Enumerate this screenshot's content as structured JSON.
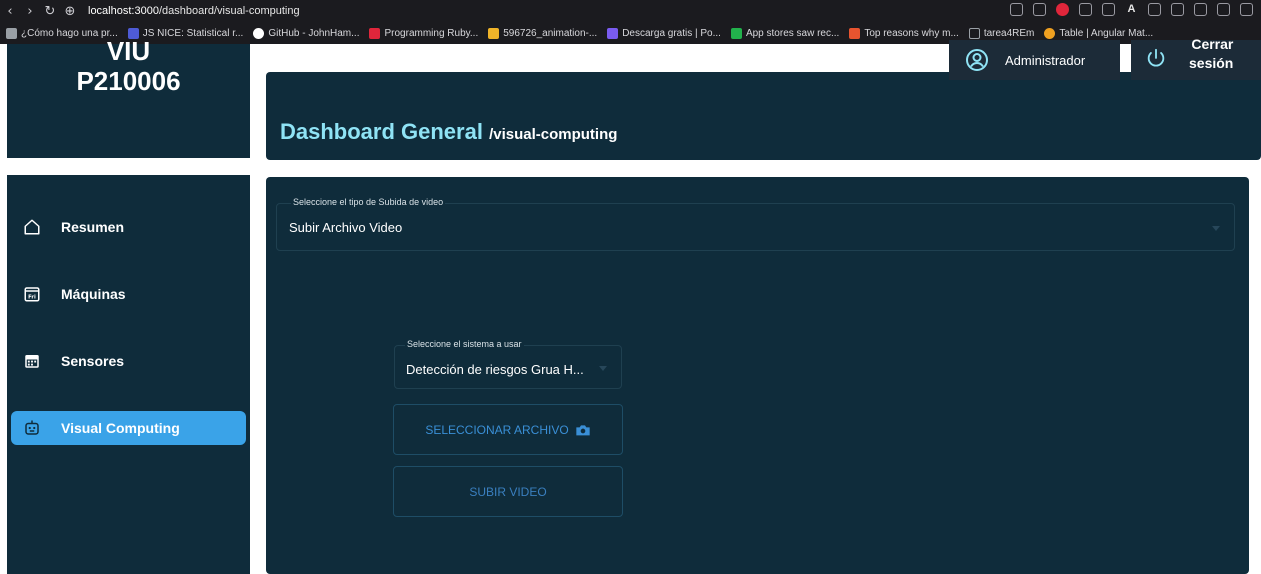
{
  "browser": {
    "url_host": "localhost:3000",
    "url_path": "/dashboard/visual-computing",
    "bookmarks": [
      {
        "label": "¿Cómo hago una pr...",
        "color": "#9aa0a6"
      },
      {
        "label": "JS NICE: Statistical r...",
        "color": "#4e5bd6"
      },
      {
        "label": "GitHub - JohnHam...",
        "color": "#ffffff"
      },
      {
        "label": "Programming Ruby...",
        "color": "#e0263b"
      },
      {
        "label": "596726_animation-...",
        "color": "#f0b429"
      },
      {
        "label": "Descarga gratis | Po...",
        "color": "#7a5cf0"
      },
      {
        "label": "App stores saw rec...",
        "color": "#22b24c"
      },
      {
        "label": "Top reasons why m...",
        "color": "#e8542f"
      },
      {
        "label": "tarea4REm",
        "color": "#9aa0a6"
      },
      {
        "label": "Table | Angular Mat...",
        "color": "#f0a020"
      }
    ],
    "ext_letter_a": "A"
  },
  "brand": {
    "line1": "VIU",
    "line2": "P210006"
  },
  "header": {
    "title": "Dashboard General",
    "path": "/visual-computing",
    "user_label": "Administrador",
    "logout_line1": "Cerrar",
    "logout_line2": "sesión"
  },
  "sidebar": {
    "items": [
      {
        "label": "Resumen",
        "icon": "home-icon"
      },
      {
        "label": "Máquinas",
        "icon": "calendar-fri-icon",
        "icon_text": "Fri"
      },
      {
        "label": "Sensores",
        "icon": "calendar-grid-icon"
      },
      {
        "label": "Visual Computing",
        "icon": "robot-icon",
        "active": true
      }
    ]
  },
  "form": {
    "upload_type_label": "Seleccione el tipo de Subida de video",
    "upload_type_value": "Subir Archivo Video",
    "system_label": "Seleccione el sistema a usar",
    "system_value": "Detección de riesgos Grua H...",
    "select_file_label": "SELECCIONAR ARCHIVO",
    "upload_label": "SUBIR VIDEO"
  },
  "colors": {
    "panel": "#0f2c3b",
    "accent": "#3aa3e8",
    "title": "#8fe3f5",
    "button_text": "#3a8fd6"
  }
}
